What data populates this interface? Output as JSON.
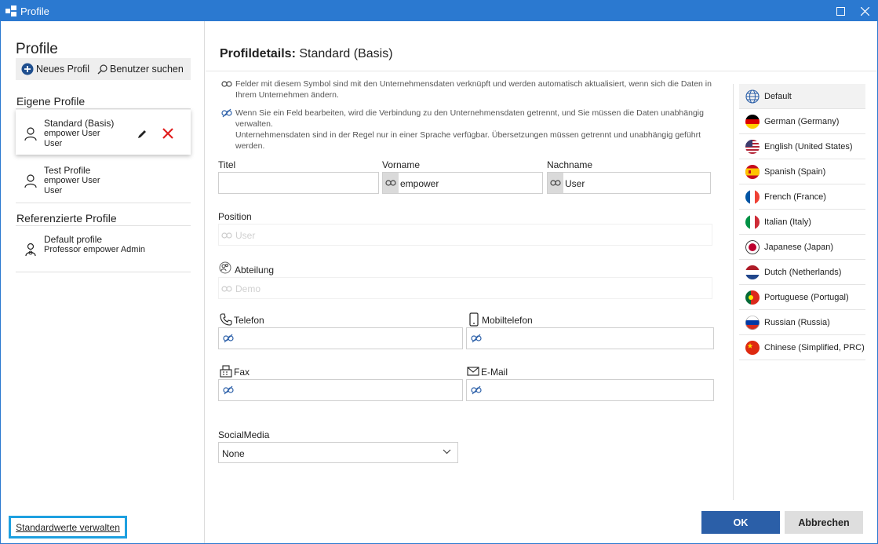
{
  "window": {
    "title": "Profile",
    "accent_color": "#2b79d0",
    "icons": {
      "app": "app-icon",
      "maximize": "maximize-icon",
      "close": "close-icon"
    }
  },
  "left": {
    "title": "Profile",
    "toolbar": {
      "new_profile": "Neues Profil",
      "search_user": "Benutzer suchen"
    },
    "own_section": "Eigene Profile",
    "own_profiles": [
      {
        "name": "Standard (Basis)",
        "line1": "empower User",
        "line2": "User",
        "icon": "user-icon",
        "selected": true
      },
      {
        "name": "Test Profile",
        "line1": "empower User",
        "line2": "User",
        "icon": "user-icon"
      }
    ],
    "ref_section": "Referenzierte Profile",
    "ref_profiles": [
      {
        "name": "Default profile",
        "line1": "Professor empower Admin",
        "icon": "admin-user-icon"
      }
    ],
    "manage_defaults": "Standardwerte verwalten",
    "manage_defaults_highlight": "#1ea0e0"
  },
  "main": {
    "title_bold": "Profildetails:",
    "title_rest": "Standard (Basis)",
    "info_linked": "Felder mit diesem Symbol sind mit den Unternehmensdaten verknüpft und werden automatisch aktualisiert, wenn sich die Daten in Ihrem Unternehmen ändern.",
    "info_unlinked": "Wenn Sie ein Feld bearbeiten, wird die Verbindung zu den Unternehmensdaten getrennt, und Sie müssen die Daten unabhängig verwalten.",
    "info_translation": "Unternehmensdaten sind in der Regel nur in einer Sprache verfügbar. Übersetzungen müssen getrennt und unabhängig geführt werden.",
    "fields": {
      "titel": {
        "label": "Titel",
        "value": ""
      },
      "vorname": {
        "label": "Vorname",
        "value": "empower"
      },
      "nachname": {
        "label": "Nachname",
        "value": "User"
      },
      "position": {
        "label": "Position",
        "value": "User"
      },
      "abteilung": {
        "label": "Abteilung",
        "value": "Demo"
      },
      "telefon": {
        "label": "Telefon",
        "value": ""
      },
      "mobiltelefon": {
        "label": "Mobiltelefon",
        "value": ""
      },
      "fax": {
        "label": "Fax",
        "value": ""
      },
      "email": {
        "label": "E-Mail",
        "value": ""
      },
      "social": {
        "label": "SocialMedia",
        "value": "None"
      }
    },
    "languages": [
      {
        "name": "Default",
        "icon": "globe-icon",
        "selected": true
      },
      {
        "name": "German (Germany)",
        "icon": "flag-de-icon"
      },
      {
        "name": "English (United States)",
        "icon": "flag-us-icon"
      },
      {
        "name": "Spanish (Spain)",
        "icon": "flag-es-icon"
      },
      {
        "name": "French (France)",
        "icon": "flag-fr-icon"
      },
      {
        "name": "Italian (Italy)",
        "icon": "flag-it-icon"
      },
      {
        "name": "Japanese (Japan)",
        "icon": "flag-jp-icon"
      },
      {
        "name": "Dutch (Netherlands)",
        "icon": "flag-nl-icon"
      },
      {
        "name": "Portuguese (Portugal)",
        "icon": "flag-pt-icon"
      },
      {
        "name": "Russian (Russia)",
        "icon": "flag-ru-icon"
      },
      {
        "name": "Chinese (Simplified, PRC)",
        "icon": "flag-cn-icon"
      }
    ],
    "buttons": {
      "ok": "OK",
      "cancel": "Abbrechen"
    },
    "ok_color": "#2b5fa8"
  }
}
